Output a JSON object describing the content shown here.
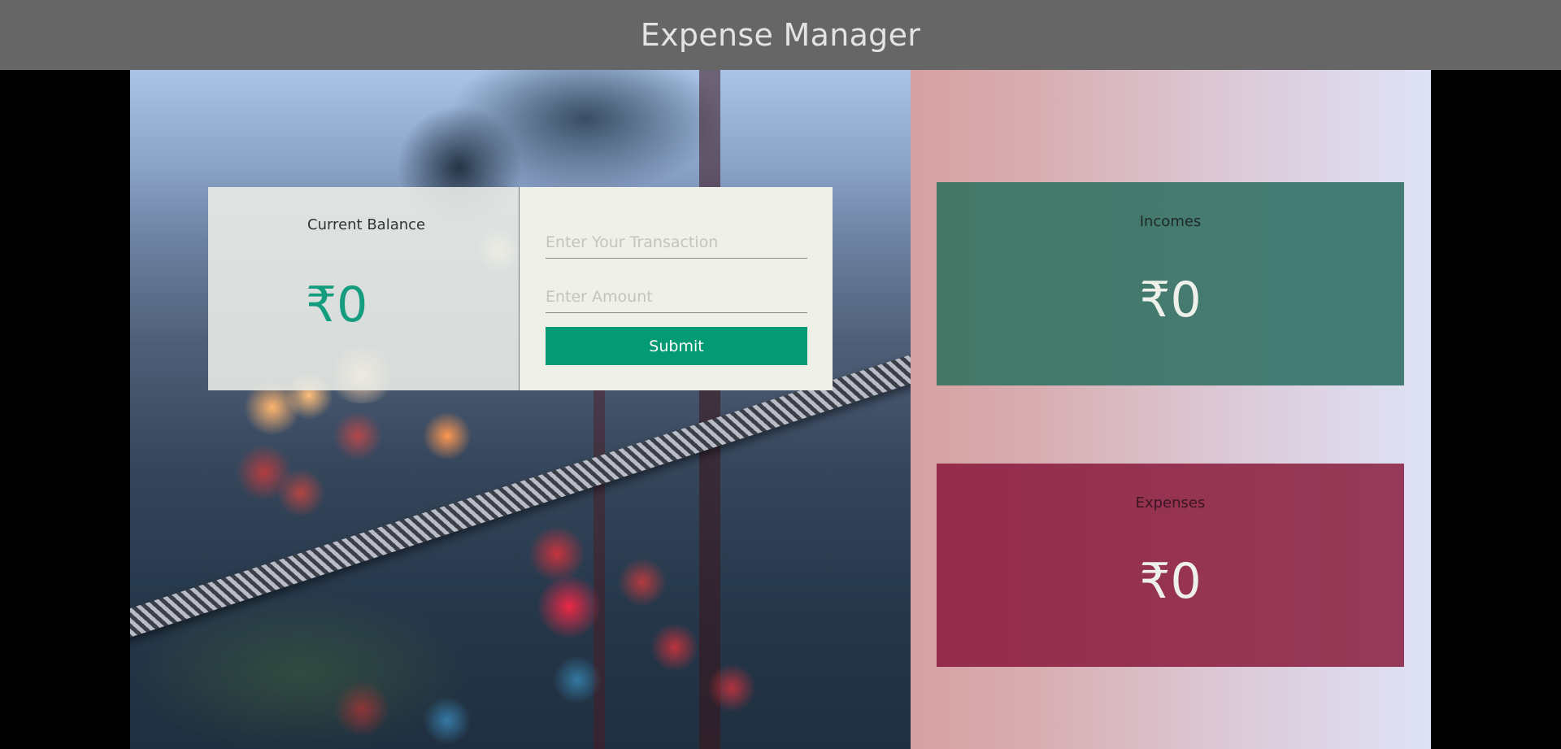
{
  "header": {
    "title": "Expense Manager"
  },
  "balance": {
    "label": "Current Balance",
    "value": "₹0"
  },
  "form": {
    "transaction_placeholder": "Enter Your Transaction",
    "amount_placeholder": "Enter Amount",
    "submit_label": "Submit"
  },
  "income": {
    "label": "Incomes",
    "value": "₹0"
  },
  "expense": {
    "label": "Expenses",
    "value": "₹0"
  },
  "colors": {
    "header_bg": "#666666",
    "accent": "#039a74",
    "income_bg": "#447a6f",
    "expense_bg": "#963352"
  }
}
